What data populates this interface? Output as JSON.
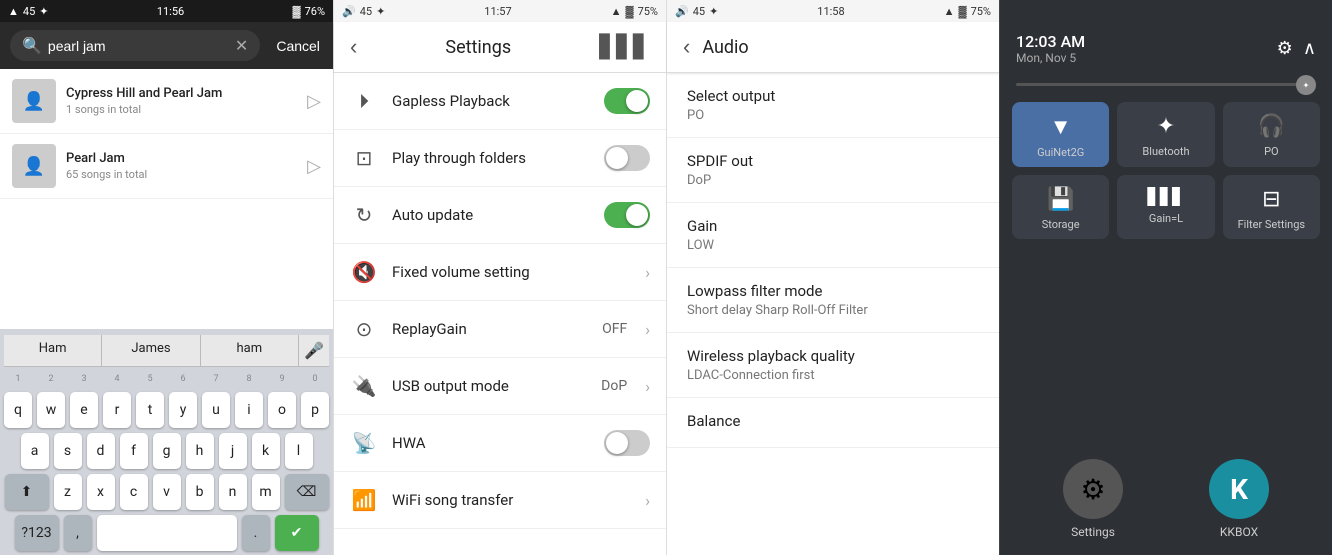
{
  "panel1": {
    "status": {
      "left": "45",
      "time": "11:56",
      "battery": "76%"
    },
    "search": {
      "placeholder": "pearl jam",
      "cancel_label": "Cancel"
    },
    "songs": [
      {
        "title": "Cypress Hill and Pearl Jam",
        "count": "1 songs in total"
      },
      {
        "title": "Pearl Jam",
        "count": "65 songs in total"
      }
    ],
    "keyboard": {
      "suggestions": [
        "Ham",
        "James",
        "ham"
      ],
      "rows": [
        [
          "1",
          "2",
          "3",
          "4",
          "5",
          "6",
          "7",
          "8",
          "9",
          "0"
        ],
        [
          "q",
          "w",
          "e",
          "r",
          "t",
          "y",
          "u",
          "i",
          "o",
          "p"
        ],
        [
          "a",
          "s",
          "d",
          "f",
          "g",
          "h",
          "j",
          "k",
          "l"
        ],
        [
          "z",
          "x",
          "c",
          "v",
          "b",
          "n",
          "m"
        ]
      ],
      "special": [
        "?123",
        ",",
        ".",
        "⌫"
      ]
    }
  },
  "panel2": {
    "status": {
      "left": "45",
      "time": "11:57",
      "battery": "75%"
    },
    "header": {
      "title": "Settings",
      "back_label": "‹",
      "bars_label": "▋▋▋"
    },
    "items": [
      {
        "id": "gapless",
        "label": "Gapless Playback",
        "type": "toggle",
        "state": "on",
        "icon": "⏵"
      },
      {
        "id": "playfolder",
        "label": "Play through folders",
        "type": "toggle",
        "state": "off",
        "icon": "⊡"
      },
      {
        "id": "autoupdate",
        "label": "Auto update",
        "type": "toggle",
        "state": "on",
        "icon": "↻"
      },
      {
        "id": "fixedvolume",
        "label": "Fixed volume setting",
        "type": "chevron",
        "state": "",
        "icon": "🔇"
      },
      {
        "id": "replaygain",
        "label": "ReplayGain",
        "type": "value-chevron",
        "value": "OFF",
        "icon": "⊙"
      },
      {
        "id": "usboutput",
        "label": "USB output mode",
        "type": "value-chevron",
        "value": "DoP",
        "icon": "🔌"
      },
      {
        "id": "hwa",
        "label": "HWA",
        "type": "toggle",
        "state": "off",
        "icon": "📡"
      },
      {
        "id": "wifisong",
        "label": "WiFi song transfer",
        "type": "chevron",
        "state": "",
        "icon": "📶"
      }
    ]
  },
  "panel3": {
    "status": {
      "left": "45",
      "time": "11:58",
      "battery": "75%"
    },
    "header": {
      "title": "Audio",
      "back_label": "‹"
    },
    "items": [
      {
        "id": "selectoutput",
        "title": "Select output",
        "sub": "PO"
      },
      {
        "id": "spdifout",
        "title": "SPDIF out",
        "sub": "DoP"
      },
      {
        "id": "gain",
        "title": "Gain",
        "sub": "LOW"
      },
      {
        "id": "lowpassfilter",
        "title": "Lowpass filter mode",
        "sub": "Short delay Sharp Roll-Off Filter"
      },
      {
        "id": "wirelessquality",
        "title": "Wireless playback quality",
        "sub": "LDAC-Connection first"
      },
      {
        "id": "balance",
        "title": "Balance",
        "sub": ""
      }
    ]
  },
  "panel4": {
    "status": {
      "time": "12:03 AM",
      "date": "Mon, Nov 5"
    },
    "tiles": [
      {
        "id": "wifi",
        "icon": "▼",
        "label": "GuiNet2G",
        "active": true
      },
      {
        "id": "bluetooth",
        "icon": "✦",
        "label": "Bluetooth",
        "active": false
      },
      {
        "id": "po",
        "icon": "🎧",
        "label": "PO",
        "active": false
      },
      {
        "id": "storage",
        "icon": "💾",
        "label": "Storage",
        "active": false
      },
      {
        "id": "gainl",
        "icon": "▋▋▋",
        "label": "Gain=L",
        "active": false
      },
      {
        "id": "filtersettings",
        "icon": "⊟",
        "label": "Filter Settings",
        "active": false
      }
    ],
    "apps": [
      {
        "id": "settings",
        "icon": "⚙",
        "label": "Settings"
      },
      {
        "id": "kkbox",
        "icon": "K",
        "label": "KKBOX"
      }
    ]
  }
}
